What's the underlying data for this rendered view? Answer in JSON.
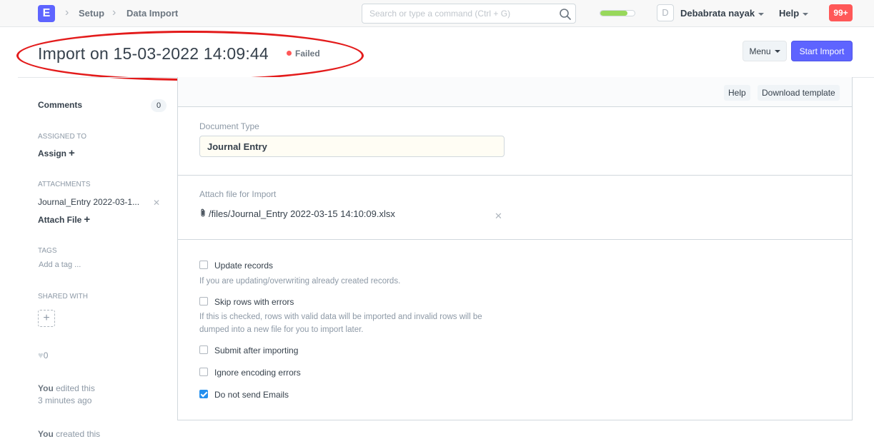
{
  "navbar": {
    "logo_letter": "E",
    "breadcrumbs": [
      "Setup",
      "Data Import"
    ],
    "search_placeholder": "Search or type a command (Ctrl + G)",
    "setup_progress": 0.8,
    "avatar_letter": "D",
    "user_name": "Debabrata nayak",
    "help_label": "Help",
    "notification_count": "99+"
  },
  "header": {
    "title": "Import on 15-03-2022 14:09:44",
    "status": "Failed",
    "status_color": "#ff5858",
    "menu_label": "Menu",
    "primary_action": "Start Import",
    "accent_color": "#5e64ff"
  },
  "sidebar": {
    "comments_label": "Comments",
    "comments_count": "0",
    "assigned_to_label": "ASSIGNED TO",
    "assign_label": "Assign",
    "attachments_label": "ATTACHMENTS",
    "attachment_name": "Journal_Entry 2022-03-1...",
    "attach_file_label": "Attach File",
    "tags_label": "TAGS",
    "add_tag_placeholder": "Add a tag ...",
    "shared_with_label": "SHARED WITH",
    "likes_count": "0",
    "timeline": [
      {
        "actor": "You",
        "action": "edited this",
        "time": "3 minutes ago"
      },
      {
        "actor": "You",
        "action": "created this"
      }
    ]
  },
  "form": {
    "toolbar": {
      "help_label": "Help",
      "download_label": "Download template"
    },
    "document_type_label": "Document Type",
    "document_type_value": "Journal Entry",
    "attach_file_label": "Attach file for Import",
    "attached_file_path": "/files/Journal_Entry 2022-03-15 14:10:09.xlsx",
    "options": [
      {
        "label": "Update records",
        "checked": false,
        "description": "If you are updating/overwriting already created records."
      },
      {
        "label": "Skip rows with errors",
        "checked": false,
        "description": "If this is checked, rows with valid data will be imported and invalid rows will be dumped into a new file for you to import later."
      },
      {
        "label": "Submit after importing",
        "checked": false
      },
      {
        "label": "Ignore encoding errors",
        "checked": false
      },
      {
        "label": "Do not send Emails",
        "checked": true
      }
    ]
  }
}
